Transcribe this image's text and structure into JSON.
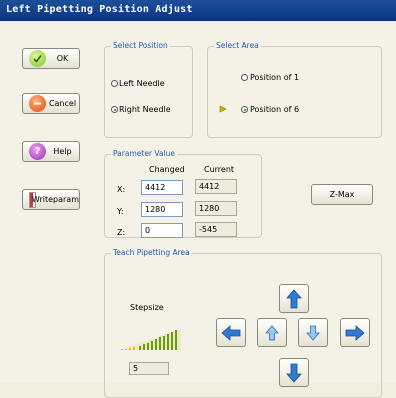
{
  "window": {
    "title": "Left Pipetting Position Adjust"
  },
  "buttons": {
    "ok": "OK",
    "cancel": "Cancel",
    "help": "Help",
    "writeparam": "Writeparam",
    "zmax": "Z-Max"
  },
  "select_position": {
    "caption": "Select Position",
    "options": [
      "Left Needle",
      "Right Needle"
    ],
    "selected": "Right Needle"
  },
  "select_area": {
    "caption": "Select Area",
    "options": [
      "Position of 1",
      "Position of 6"
    ],
    "selected": "Position of 6"
  },
  "parameter_value": {
    "caption": "Parameter Value",
    "col_changed": "Changed",
    "col_current": "Current",
    "rows": [
      {
        "axis": "X:",
        "changed": "4412",
        "current": "4412"
      },
      {
        "axis": "Y:",
        "changed": "1280",
        "current": "1280"
      },
      {
        "axis": "Z:",
        "changed": "0",
        "current": "-545"
      }
    ]
  },
  "teach": {
    "caption": "Teach Pipetting Area",
    "stepsize_label": "Stepsize",
    "stepsize_value": "5"
  },
  "icons": {
    "ok": "check-icon",
    "cancel": "minus-icon",
    "help": "question-icon",
    "writeparam": "document-icon"
  },
  "colors": {
    "title_bar": "#0a3580",
    "caption": "#2858b8",
    "arrow": "#2f7bd0",
    "slider": "#6a9a12"
  }
}
